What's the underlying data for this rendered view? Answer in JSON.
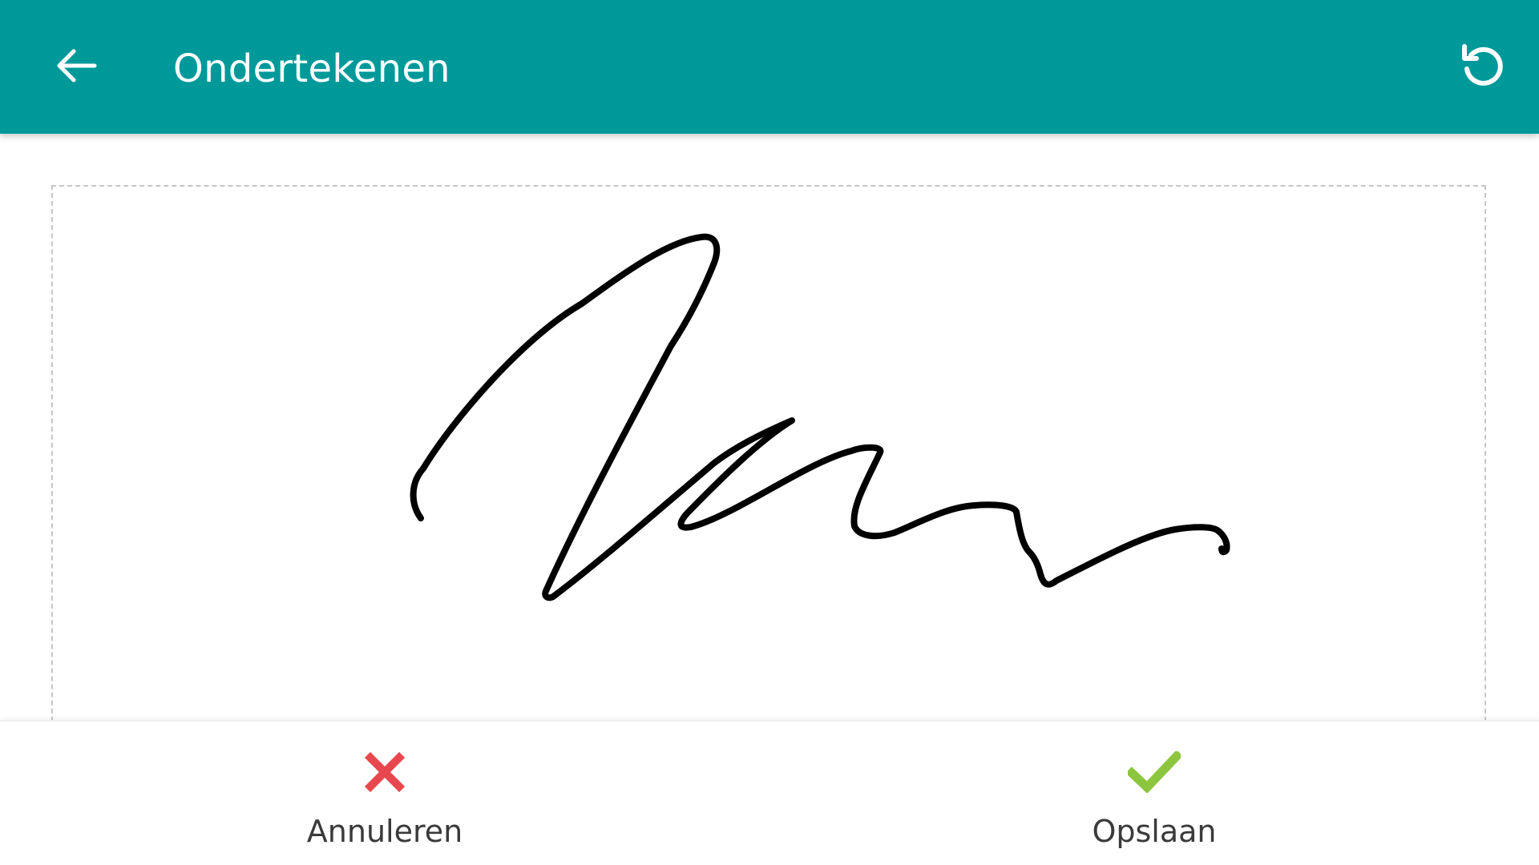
{
  "header": {
    "title": "Ondertekenen",
    "back_icon": "arrow-left-icon",
    "undo_icon": "undo-icon",
    "background_color": "#00999a"
  },
  "signature_pad": {
    "border_style": "dashed",
    "has_signature": true
  },
  "actions": {
    "cancel_label": "Annuleren",
    "cancel_icon": "close-icon",
    "cancel_color": "#e8474e",
    "save_label": "Opslaan",
    "save_icon": "checkmark-icon",
    "save_color": "#8cc63f"
  }
}
